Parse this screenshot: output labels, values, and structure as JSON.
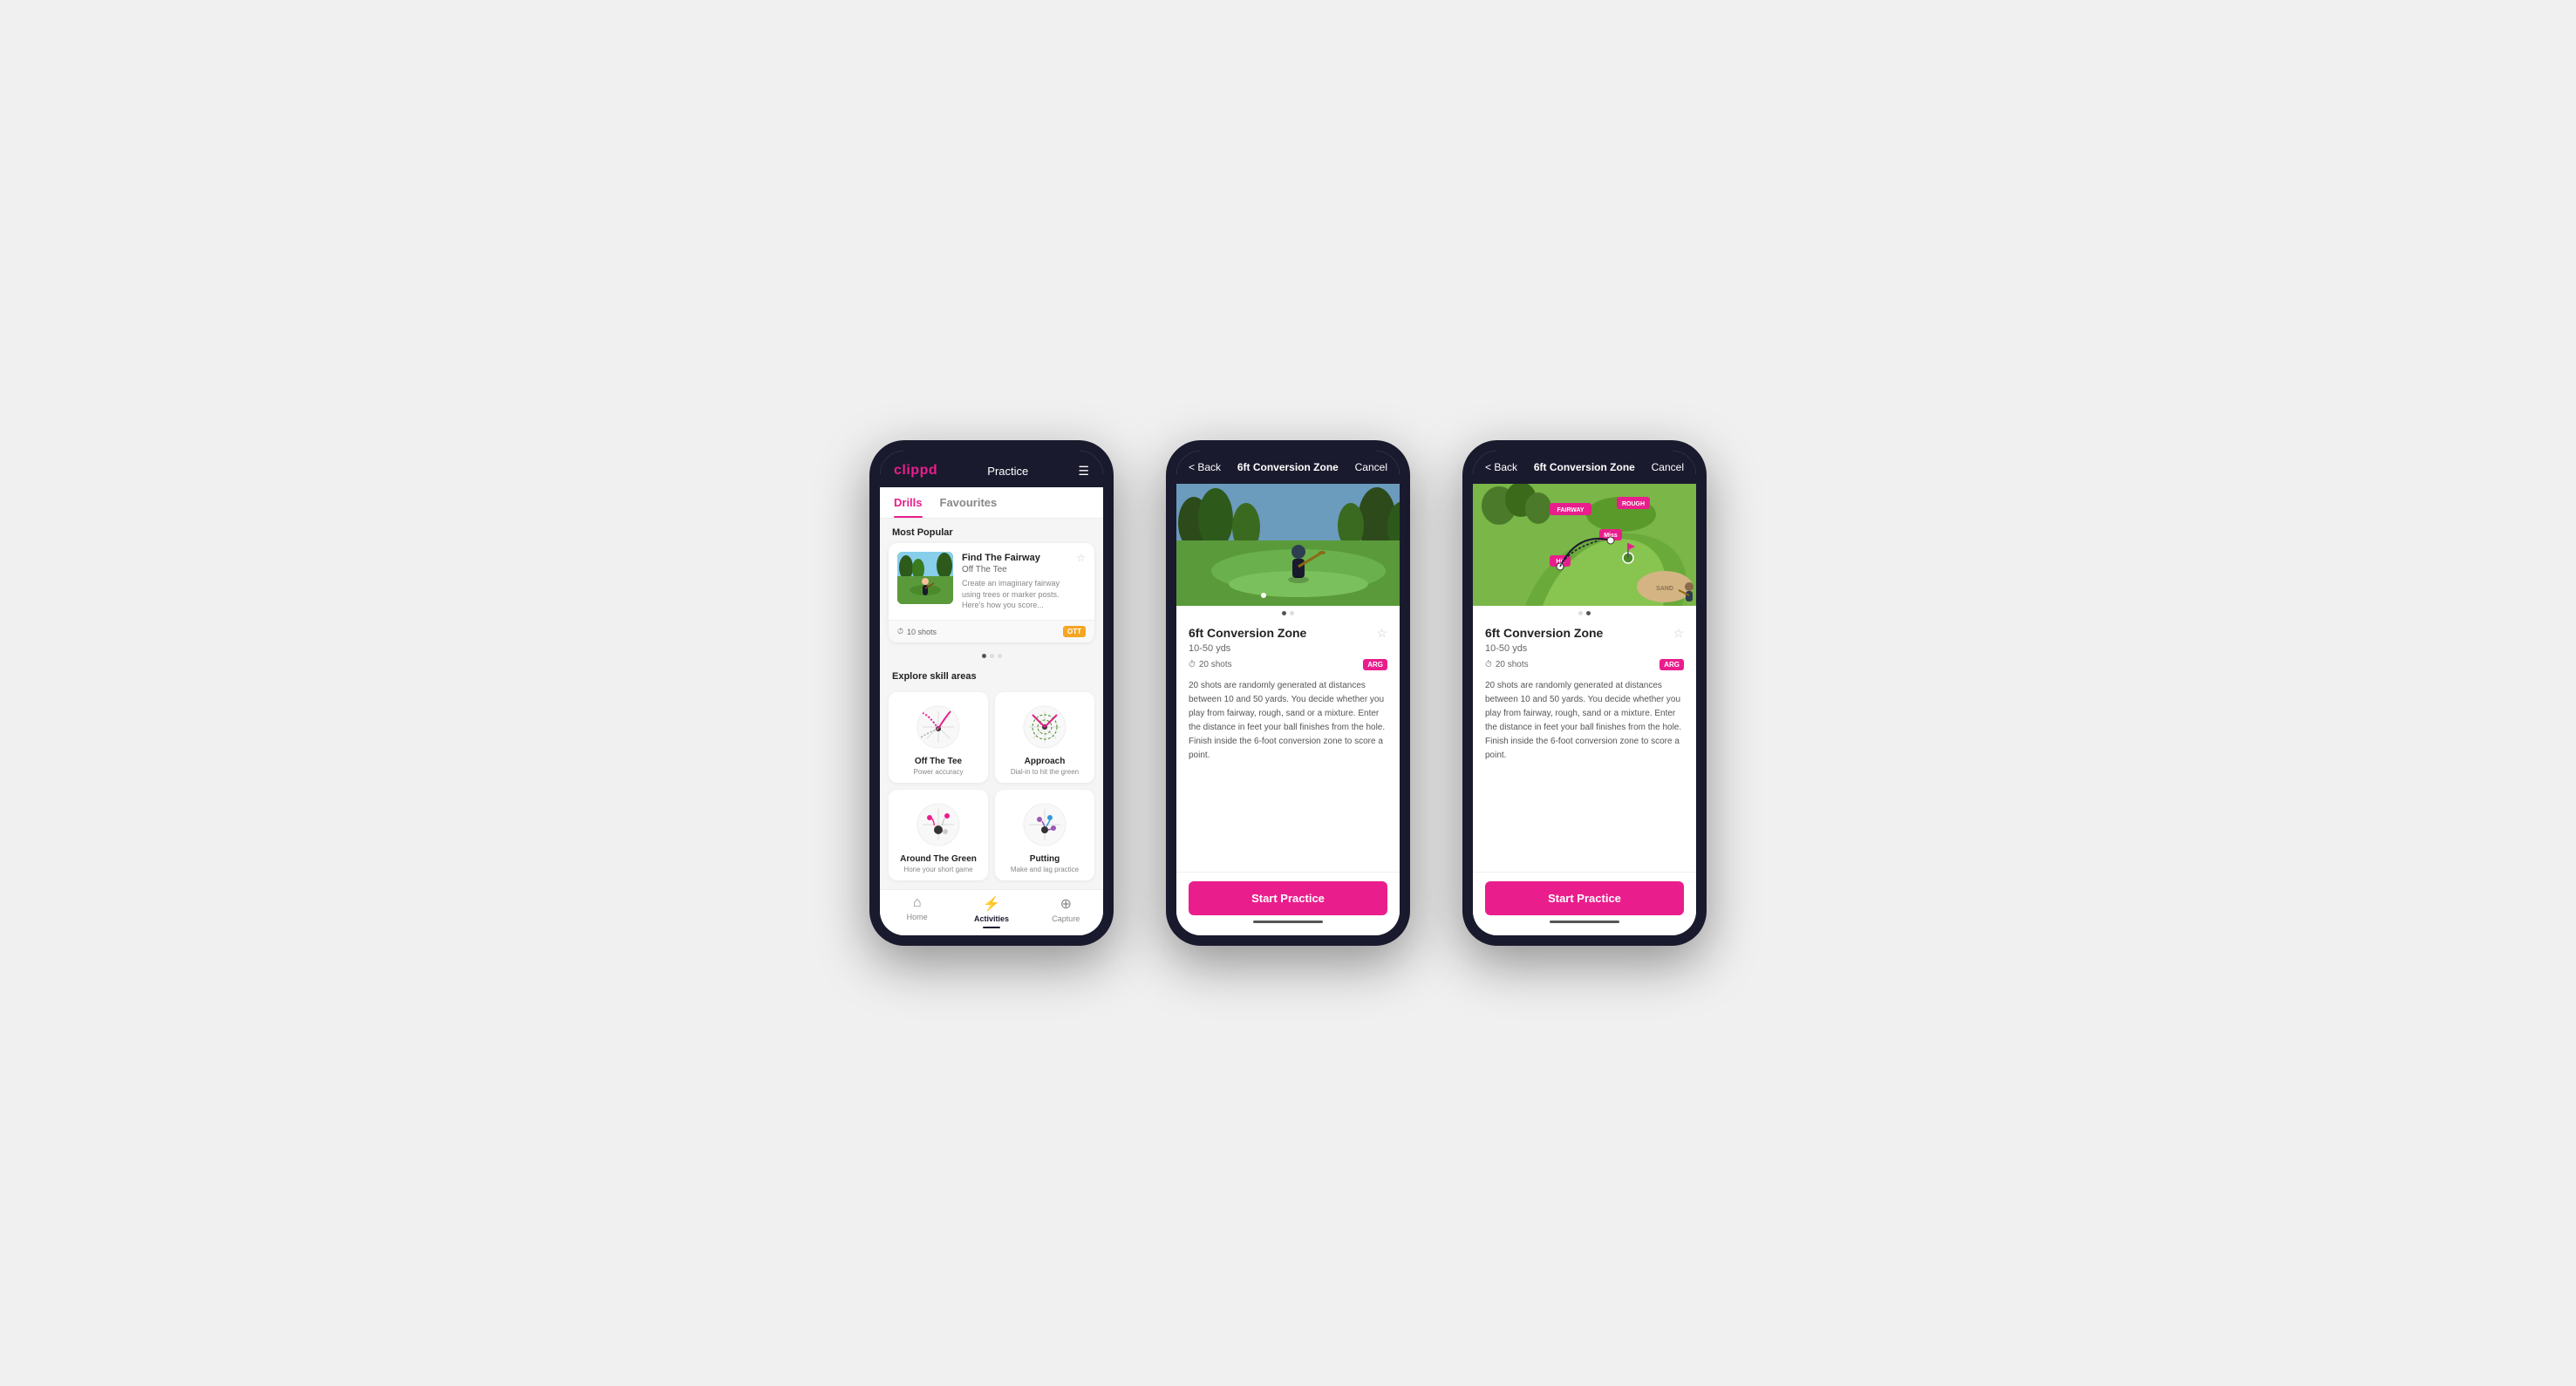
{
  "app": {
    "name": "clippd",
    "header_title": "Practice"
  },
  "phone1": {
    "tabs": [
      {
        "label": "Drills",
        "active": true
      },
      {
        "label": "Favourites",
        "active": false
      }
    ],
    "most_popular_label": "Most Popular",
    "explore_label": "Explore skill areas",
    "featured_drill": {
      "title": "Find The Fairway",
      "subtitle": "Off The Tee",
      "description": "Create an imaginary fairway using trees or marker posts. Here's how you score...",
      "shots": "10 shots",
      "tag": "OTT"
    },
    "dots": [
      {
        "active": true
      },
      {
        "active": false
      },
      {
        "active": false
      }
    ],
    "skill_areas": [
      {
        "name": "Off The Tee",
        "desc": "Power accuracy"
      },
      {
        "name": "Approach",
        "desc": "Dial-in to hit the green"
      },
      {
        "name": "Around The Green",
        "desc": "Hone your short game"
      },
      {
        "name": "Putting",
        "desc": "Make and lag practice"
      }
    ],
    "nav": [
      {
        "label": "Home",
        "icon": "🏠",
        "active": false
      },
      {
        "label": "Activities",
        "icon": "⚡",
        "active": true
      },
      {
        "label": "Capture",
        "icon": "➕",
        "active": false
      }
    ]
  },
  "phone2": {
    "header": {
      "back_label": "< Back",
      "title": "6ft Conversion Zone",
      "cancel_label": "Cancel"
    },
    "drill": {
      "title": "6ft Conversion Zone",
      "range": "10-50 yds",
      "shots": "20 shots",
      "tag": "ARG",
      "favorite": "☆",
      "description": "20 shots are randomly generated at distances between 10 and 50 yards. You decide whether you play from fairway, rough, sand or a mixture. Enter the distance in feet your ball finishes from the hole. Finish inside the 6-foot conversion zone to score a point.",
      "start_button": "Start Practice"
    },
    "dots": [
      {
        "active": true
      },
      {
        "active": false
      }
    ]
  },
  "phone3": {
    "header": {
      "back_label": "< Back",
      "title": "6ft Conversion Zone",
      "cancel_label": "Cancel"
    },
    "drill": {
      "title": "6ft Conversion Zone",
      "range": "10-50 yds",
      "shots": "20 shots",
      "tag": "ARG",
      "favorite": "☆",
      "description": "20 shots are randomly generated at distances between 10 and 50 yards. You decide whether you play from fairway, rough, sand or a mixture. Enter the distance in feet your ball finishes from the hole. Finish inside the 6-foot conversion zone to score a point.",
      "start_button": "Start Practice"
    },
    "map": {
      "fairway_label": "FAIRWAY",
      "rough_label": "ROUGH",
      "hit_label": "Hit",
      "miss_label": "Miss",
      "sand_label": "SAND"
    },
    "dots": [
      {
        "active": false
      },
      {
        "active": true
      }
    ]
  }
}
